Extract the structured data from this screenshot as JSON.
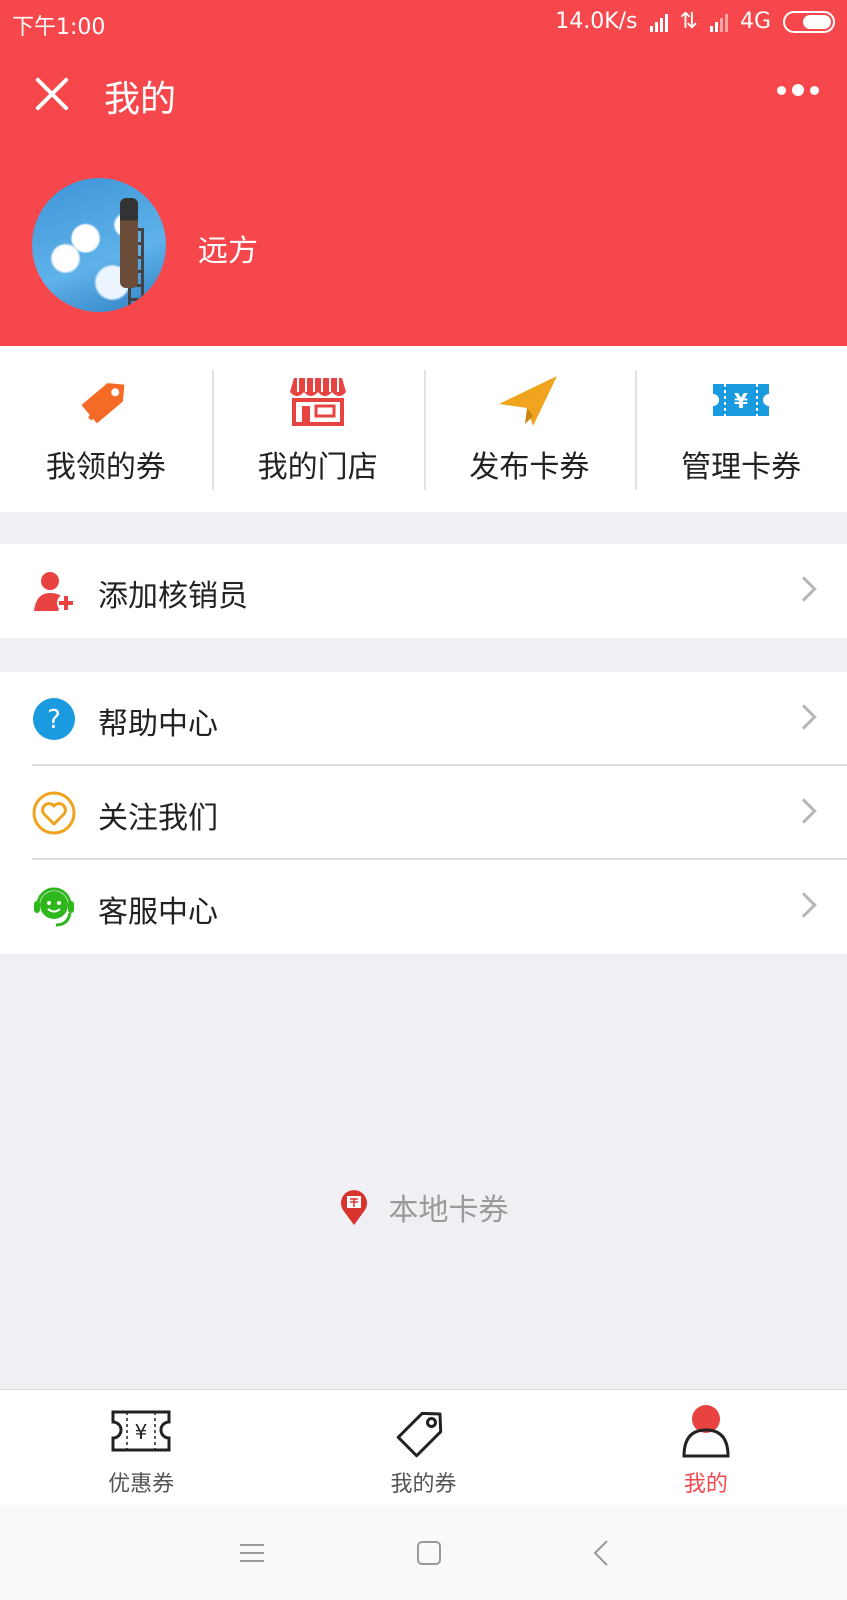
{
  "status_bar": {
    "time": "下午1:00",
    "speed": "14.0K/s",
    "network": "4G"
  },
  "nav": {
    "title": "我的"
  },
  "profile": {
    "name": "远方"
  },
  "quick_actions": [
    {
      "label": "我领的券",
      "icon": "coupon-tag-icon"
    },
    {
      "label": "我的门店",
      "icon": "store-icon"
    },
    {
      "label": "发布卡券",
      "icon": "paper-plane-icon"
    },
    {
      "label": "管理卡券",
      "icon": "ticket-yen-icon"
    }
  ],
  "menu": {
    "add_verifier": "添加核销员",
    "help_center": "帮助中心",
    "follow_us": "关注我们",
    "customer_service": "客服中心"
  },
  "footer": {
    "brand": "本地卡券"
  },
  "tabs": [
    {
      "label": "优惠券",
      "icon": "yen-ticket-icon"
    },
    {
      "label": "我的券",
      "icon": "tag-icon"
    },
    {
      "label": "我的",
      "icon": "person-icon",
      "active": true
    }
  ],
  "colors": {
    "brand": "#f6484c",
    "orange": "#f56a24",
    "blue": "#1a9be0",
    "gold": "#f0a31c",
    "green": "#2fb81e"
  }
}
